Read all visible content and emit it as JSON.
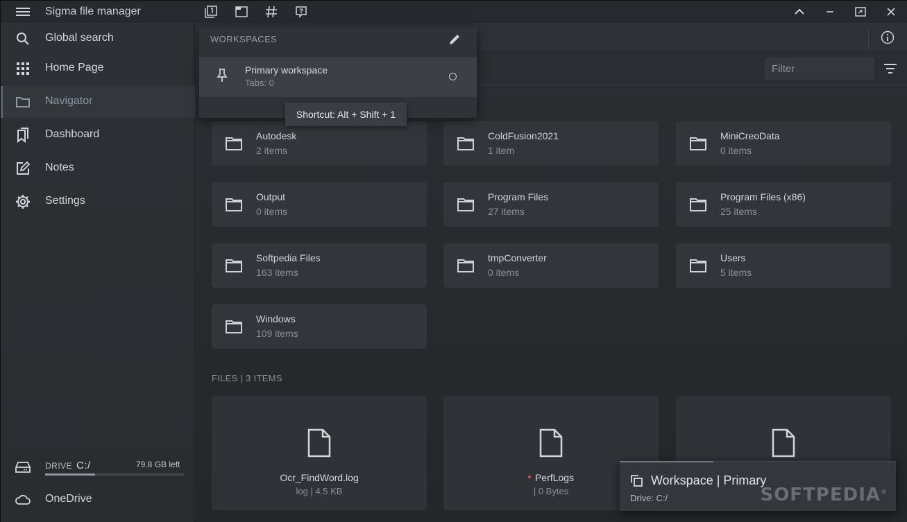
{
  "app": {
    "title": "Sigma file manager"
  },
  "sidebar": {
    "items": [
      {
        "label": "Global search",
        "icon": "search-icon"
      },
      {
        "label": "Home Page",
        "icon": "grid-icon"
      },
      {
        "label": "Navigator",
        "icon": "folder-icon",
        "active": true
      },
      {
        "label": "Dashboard",
        "icon": "bookmarks-icon"
      },
      {
        "label": "Notes",
        "icon": "edit-note-icon"
      },
      {
        "label": "Settings",
        "icon": "gear-icon"
      }
    ],
    "drive": {
      "label": "DRIVE",
      "letter": "C:/",
      "free": "79.8 GB left",
      "used_fraction": 0.36
    },
    "onedrive": {
      "label": "OneDrive"
    }
  },
  "filter": {
    "placeholder": "Filter"
  },
  "workspaces": {
    "header": "WORKSPACES",
    "item": {
      "name": "Primary workspace",
      "tabs": "Tabs: 0"
    },
    "tooltip": "Shortcut: Alt + Shift + 1"
  },
  "directories": [
    {
      "name": "Autodesk",
      "count": "2 items"
    },
    {
      "name": "ColdFusion2021",
      "count": "1 item"
    },
    {
      "name": "MiniCreoData",
      "count": "0 items"
    },
    {
      "name": "Output",
      "count": "0 items"
    },
    {
      "name": "Program Files",
      "count": "27 items"
    },
    {
      "name": "Program Files (x86)",
      "count": "25 items"
    },
    {
      "name": "Softpedia Files",
      "count": "163 items"
    },
    {
      "name": "tmpConverter",
      "count": "0 items"
    },
    {
      "name": "Users",
      "count": "5 items"
    },
    {
      "name": "Windows",
      "count": "109 items"
    }
  ],
  "files": {
    "header": "FILES | 3 ITEMS",
    "items": [
      {
        "name": "Ocr_FindWord.log",
        "meta": "log | 4.5 KB"
      },
      {
        "name": "PerfLogs",
        "meta": "| 0 Bytes"
      },
      {
        "name": "",
        "meta": ""
      }
    ]
  },
  "notification": {
    "title": "Workspace | Primary",
    "subtitle": "Drive: C:/",
    "progress_fraction": 0.34,
    "watermark": "SOFTPEDIA"
  },
  "colors": {
    "accent": "#8d99a6",
    "background": "#2a2d31",
    "card": "#32353a",
    "danger_dot": "#e0534a"
  }
}
